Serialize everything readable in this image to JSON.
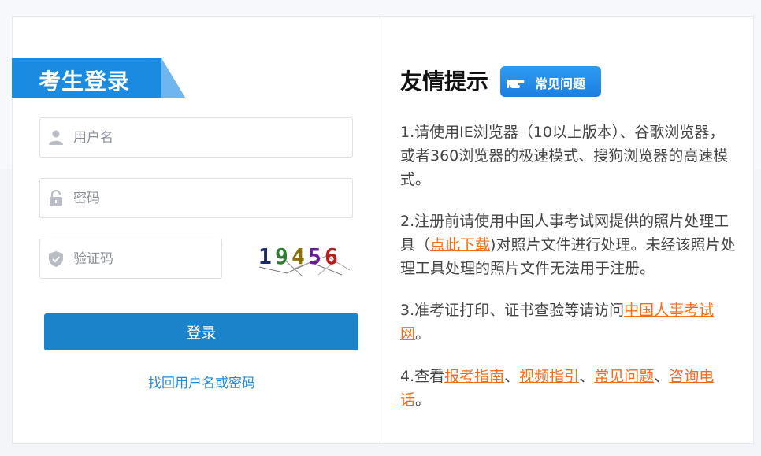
{
  "login": {
    "title": "考生登录",
    "username_placeholder": "用户名",
    "password_placeholder": "密码",
    "captcha_placeholder": "验证码",
    "captcha_chars": [
      "1",
      "9",
      "4",
      "5",
      "6"
    ],
    "captcha_colors": [
      "#1a2b6b",
      "#2e7d32",
      "#8d6e00",
      "#6a1b9a",
      "#b71c1c"
    ],
    "submit_label": "登录",
    "recover_label": "找回用户名或密码"
  },
  "tips": {
    "title": "友情提示",
    "faq_badge": "常见问题",
    "tip1": "1.请使用IE浏览器（10以上版本）、谷歌浏览器，或者360浏览器的极速模式、搜狗浏览器的高速模式。",
    "tip2_before": "2.注册前请使用中国人事考试网提供的照片处理工具（",
    "tip2_link": "点此下载",
    "tip2_after": ")对照片文件进行处理。未经该照片处理工具处理的照片文件无法用于注册。",
    "tip3_before": "3.准考证打印、证书查验等请访问",
    "tip3_link": "中国人事考试网",
    "tip3_after": "。",
    "tip4_before": "4.查看",
    "tip4_link1": "报考指南",
    "sep1": "、",
    "tip4_link2": "视频指引",
    "sep2": "、",
    "tip4_link3": "常见问题",
    "sep3": "、",
    "tip4_link4": "咨询电话",
    "tip4_after": "。"
  },
  "colors": {
    "accent": "#1a8be0",
    "button": "#1a83c9",
    "link": "#ff6a13"
  }
}
